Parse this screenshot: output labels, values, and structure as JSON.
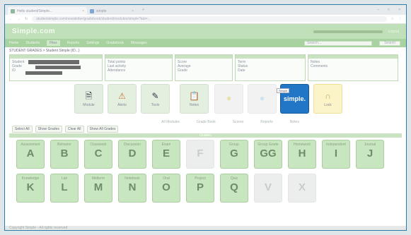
{
  "colors": {
    "brand_green": "#bfe0b8",
    "nav_green": "#a8d3a0",
    "accent_blue": "#2276c6",
    "frame": "#2f7da6"
  },
  "browser": {
    "tab1_title": "Hello student/Simple...",
    "tab2_title": "simple",
    "newtab": "+",
    "url": "studentsimple.com/newsletter/gradebook/student/modules/simple?tab=..."
  },
  "app": {
    "logo": "Simple.com",
    "header_link": "Logout",
    "nav": [
      "Home",
      "Students",
      "Files",
      "Reports",
      "Settings",
      "Gradebook",
      "Messages"
    ],
    "nav_active": "Files",
    "search_placeholder": "Search...",
    "search_button": "Search",
    "breadcrumb": "STUDENT GRADES > Student Simple (ID...)"
  },
  "panels": [
    {
      "lines": [
        "Student",
        "Grade",
        "ID"
      ]
    },
    {
      "lines": [
        "Total points",
        "Last activity",
        "Attendance"
      ]
    },
    {
      "lines": [
        "Score",
        "Average",
        "Grade"
      ]
    },
    {
      "lines": [
        "Term",
        "Status",
        "Date"
      ]
    },
    {
      "lines": [
        "Notes",
        "Comments"
      ]
    }
  ],
  "modules": [
    {
      "label": "Module",
      "icon": "document-icon"
    },
    {
      "label": "Alerts",
      "icon": "warning-icon"
    },
    {
      "label": "Tools",
      "icon": "pencil-icon"
    },
    {
      "label": "Notes",
      "icon": "notes-icon"
    },
    {
      "label": "",
      "icon": "lightbulb-icon"
    },
    {
      "label": "",
      "icon": "lightbulb-icon"
    },
    {
      "label": "simple.",
      "icon": "simple-logo-icon"
    },
    {
      "label": "Lock",
      "icon": "lock-icon"
    }
  ],
  "tooltip": "Simple",
  "subtabs": [
    "All Modules",
    "Grade Book",
    "Scores",
    "Reports",
    "Notes"
  ],
  "filters": [
    "Select All",
    "Show Grades",
    "Clear All",
    "Show All Grades"
  ],
  "grid_header": "Grades",
  "grades": [
    {
      "letter": "A",
      "cap": "Assessment",
      "dim": false
    },
    {
      "letter": "B",
      "cap": "Behavior",
      "dim": false
    },
    {
      "letter": "C",
      "cap": "Classwork",
      "dim": false
    },
    {
      "letter": "D",
      "cap": "Discussion",
      "dim": false
    },
    {
      "letter": "E",
      "cap": "Exam",
      "dim": false
    },
    {
      "letter": "F",
      "cap": "",
      "dim": true
    },
    {
      "letter": "G",
      "cap": "Group",
      "dim": false
    },
    {
      "letter": "GG",
      "cap": "Group Grade",
      "dim": false
    },
    {
      "letter": "H",
      "cap": "Homework",
      "dim": false
    },
    {
      "letter": "I",
      "cap": "Independent",
      "dim": false
    },
    {
      "letter": "J",
      "cap": "Journal",
      "dim": false
    },
    {
      "letter": "K",
      "cap": "Knowledge",
      "dim": false
    },
    {
      "letter": "L",
      "cap": "Lab",
      "dim": false
    },
    {
      "letter": "M",
      "cap": "Midterm",
      "dim": false
    },
    {
      "letter": "N",
      "cap": "Notebook",
      "dim": false
    },
    {
      "letter": "O",
      "cap": "Oral",
      "dim": false
    },
    {
      "letter": "P",
      "cap": "Project",
      "dim": false
    },
    {
      "letter": "Q",
      "cap": "Quiz",
      "dim": false
    },
    {
      "letter": "V",
      "cap": "",
      "dim": true
    },
    {
      "letter": "X",
      "cap": "",
      "dim": true
    }
  ],
  "footer": "Copyright Simple - All rights reserved"
}
